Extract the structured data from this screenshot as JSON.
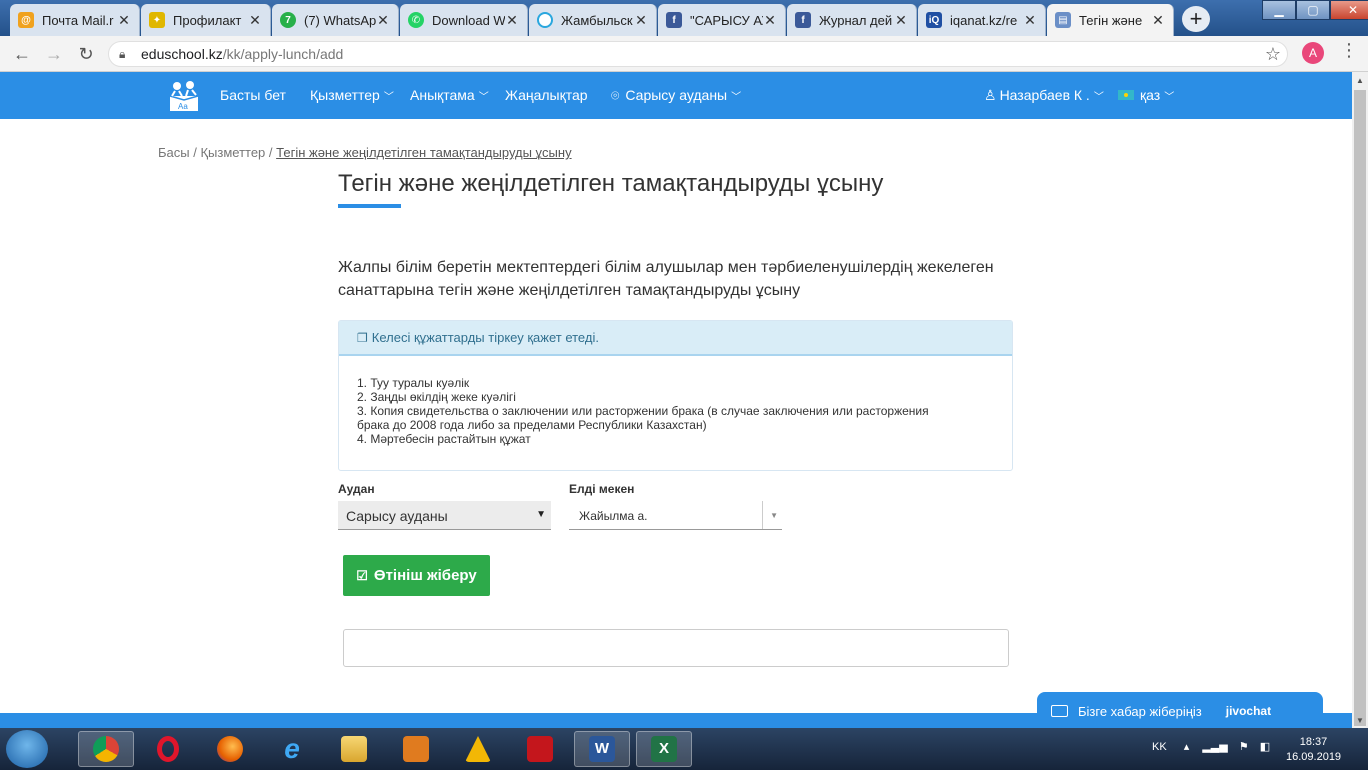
{
  "browser": {
    "tabs": [
      {
        "label": "Почта Mail.r",
        "icon": "mail-at-icon",
        "color": "#f0a21e"
      },
      {
        "label": "Профилакт",
        "icon": "lightbulb-icon",
        "color": "#e0b700"
      },
      {
        "label": "(7) WhatsAp",
        "icon": "whatsapp-badge-icon",
        "color": "#28b04a"
      },
      {
        "label": "Download W",
        "icon": "whatsapp-icon",
        "color": "#25d366"
      },
      {
        "label": "Жамбыльск",
        "icon": "loading-icon",
        "color": "#2aa7de"
      },
      {
        "label": "\"САРЫСУ АУ",
        "icon": "facebook-icon",
        "color": "#3b5998"
      },
      {
        "label": "Журнал дей",
        "icon": "facebook-icon",
        "color": "#3b5998"
      },
      {
        "label": "iqanat.kz/re",
        "icon": "iqanat-icon",
        "color": "#1f4fa3"
      },
      {
        "label": "Тегін және",
        "icon": "page-icon",
        "color": "#6b8fc7"
      }
    ],
    "url_host": "eduschool.kz",
    "url_path": "/kk/apply-lunch/add",
    "profile_initial": "A"
  },
  "navbar": {
    "home": "Басты бет",
    "services": "Қызметтер",
    "reference": "Анықтама",
    "news": "Жаңалықтар",
    "district": "Сарысу ауданы",
    "user": "Назарбаев К .",
    "language": "қаз"
  },
  "breadcrumb": {
    "home": "Басы",
    "sep": " / ",
    "services": "Қызметтер",
    "current": "Тегін және жеңілдетілген тамақтандыруды ұсыну"
  },
  "page": {
    "title": "Тегін және жеңілдетілген тамақтандыруды ұсыну",
    "lead": "Жалпы білім беретін мектептердегі білім алушылар мен тәрбиеленушілердің жекелеген санаттарына тегін және жеңілдетілген тамақтандыруды ұсыну"
  },
  "documents": {
    "heading": "Келесі құжаттарды тіркеу қажет етеді.",
    "items": [
      "1. Туу туралы куәлік",
      "2. Заңды өкілдің жеке куәлігі",
      "3. Копия свидетельства о заключении или расторжении брака (в случае заключения или расторжения брака до 2008 года либо за пределами Республики Казахстан)",
      "4. Мәртебесін растайтын құжат"
    ]
  },
  "form": {
    "district_label": "Аудан",
    "district_value": "Сарысу ауданы",
    "locality_label": "Елді мекен",
    "locality_value": "Жайылма а.",
    "submit_label": "Өтініш жіберу"
  },
  "chat": {
    "label": "Бізге хабар жіберіңіз",
    "brand": "jivochat"
  },
  "taskbar": {
    "apps": [
      "chrome-icon",
      "opera-icon",
      "firefox-icon",
      "internet-explorer-icon",
      "file-explorer-icon",
      "media-player-icon",
      "archive-icon",
      "acrobat-icon",
      "word-icon",
      "excel-icon"
    ],
    "lang": "KK",
    "time": "18:37",
    "date": "16.09.2019"
  },
  "colors": {
    "brand_blue": "#2b8ee5",
    "submit_green": "#2daa4a",
    "info_bg": "#d9edf7"
  }
}
